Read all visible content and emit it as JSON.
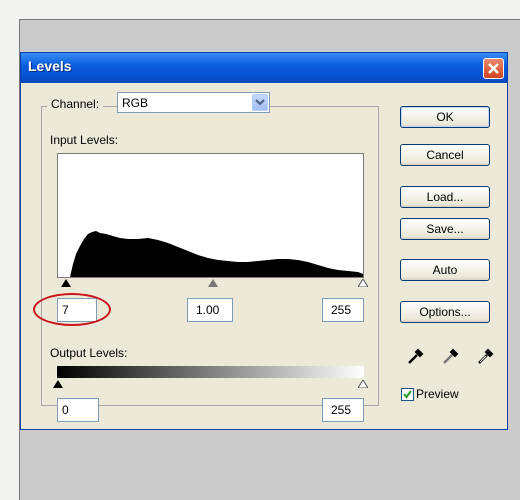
{
  "dialog": {
    "title": "Levels",
    "channel_label": "Channel:",
    "channel_value": "RGB",
    "input_levels_label": "Input Levels:",
    "input_black": "7",
    "input_gamma": "1.00",
    "input_white": "255",
    "output_levels_label": "Output Levels:",
    "output_black": "0",
    "output_white": "255",
    "buttons": {
      "ok": "OK",
      "cancel": "Cancel",
      "load": "Load...",
      "save": "Save...",
      "auto": "Auto",
      "options": "Options..."
    },
    "preview_label": "Preview",
    "preview_checked": true
  },
  "colors": {
    "title_bar": "#0a5fde",
    "close_button": "#d0421d",
    "highlight_circle": "#c8141b"
  },
  "icons": [
    "close-icon",
    "dropdown-arrow-icon",
    "black-eyedropper-icon",
    "gray-eyedropper-icon",
    "white-eyedropper-icon",
    "checkmark-icon"
  ]
}
